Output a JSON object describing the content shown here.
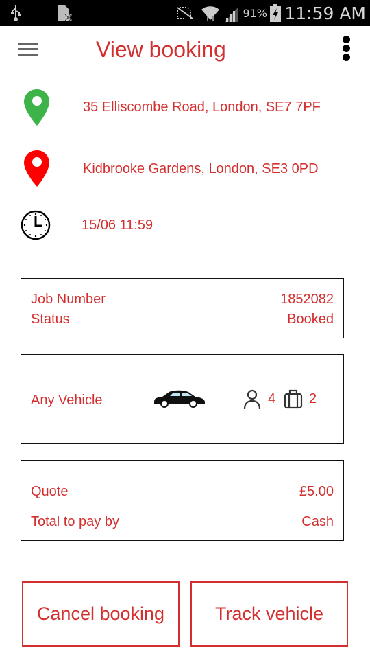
{
  "status_bar": {
    "icons": [
      "usb-icon",
      "no-sim-icon",
      "mute-icon",
      "wifi-icon",
      "signal-icon",
      "battery-charging-icon"
    ],
    "battery": "91%",
    "time": "11:59 AM"
  },
  "app_bar": {
    "menu_icon": "hamburger-menu-icon",
    "title": "View booking",
    "overflow_icon": "more-vert-icon"
  },
  "journey": {
    "pickup": {
      "icon": "pickup-pin-icon",
      "color": "#3db34a",
      "address": "35 Elliscombe Road, London, SE7 7PF"
    },
    "dropoff": {
      "icon": "dropoff-pin-icon",
      "color": "#ff0000",
      "address": "Kidbrooke Gardens, London, SE3 0PD"
    },
    "time": {
      "icon": "clock-icon",
      "value": "15/06 11:59"
    }
  },
  "job_card": {
    "job_number_label": "Job Number",
    "job_number": "1852082",
    "status_label": "Status",
    "status": "Booked"
  },
  "vehicle_card": {
    "vehicle_type": "Any Vehicle",
    "vehicle_icon": "car-icon",
    "passenger_icon": "person-icon",
    "passengers": "4",
    "luggage_icon": "luggage-icon",
    "luggage": "2"
  },
  "payment_card": {
    "quote_label": "Quote",
    "quote": "£5.00",
    "pay_label": "Total to pay by",
    "pay_method": "Cash"
  },
  "actions": {
    "cancel": "Cancel booking",
    "track": "Track vehicle"
  },
  "colors": {
    "accent": "#d32f2f",
    "pickup": "#3db34a",
    "dropoff": "#ff0000"
  }
}
